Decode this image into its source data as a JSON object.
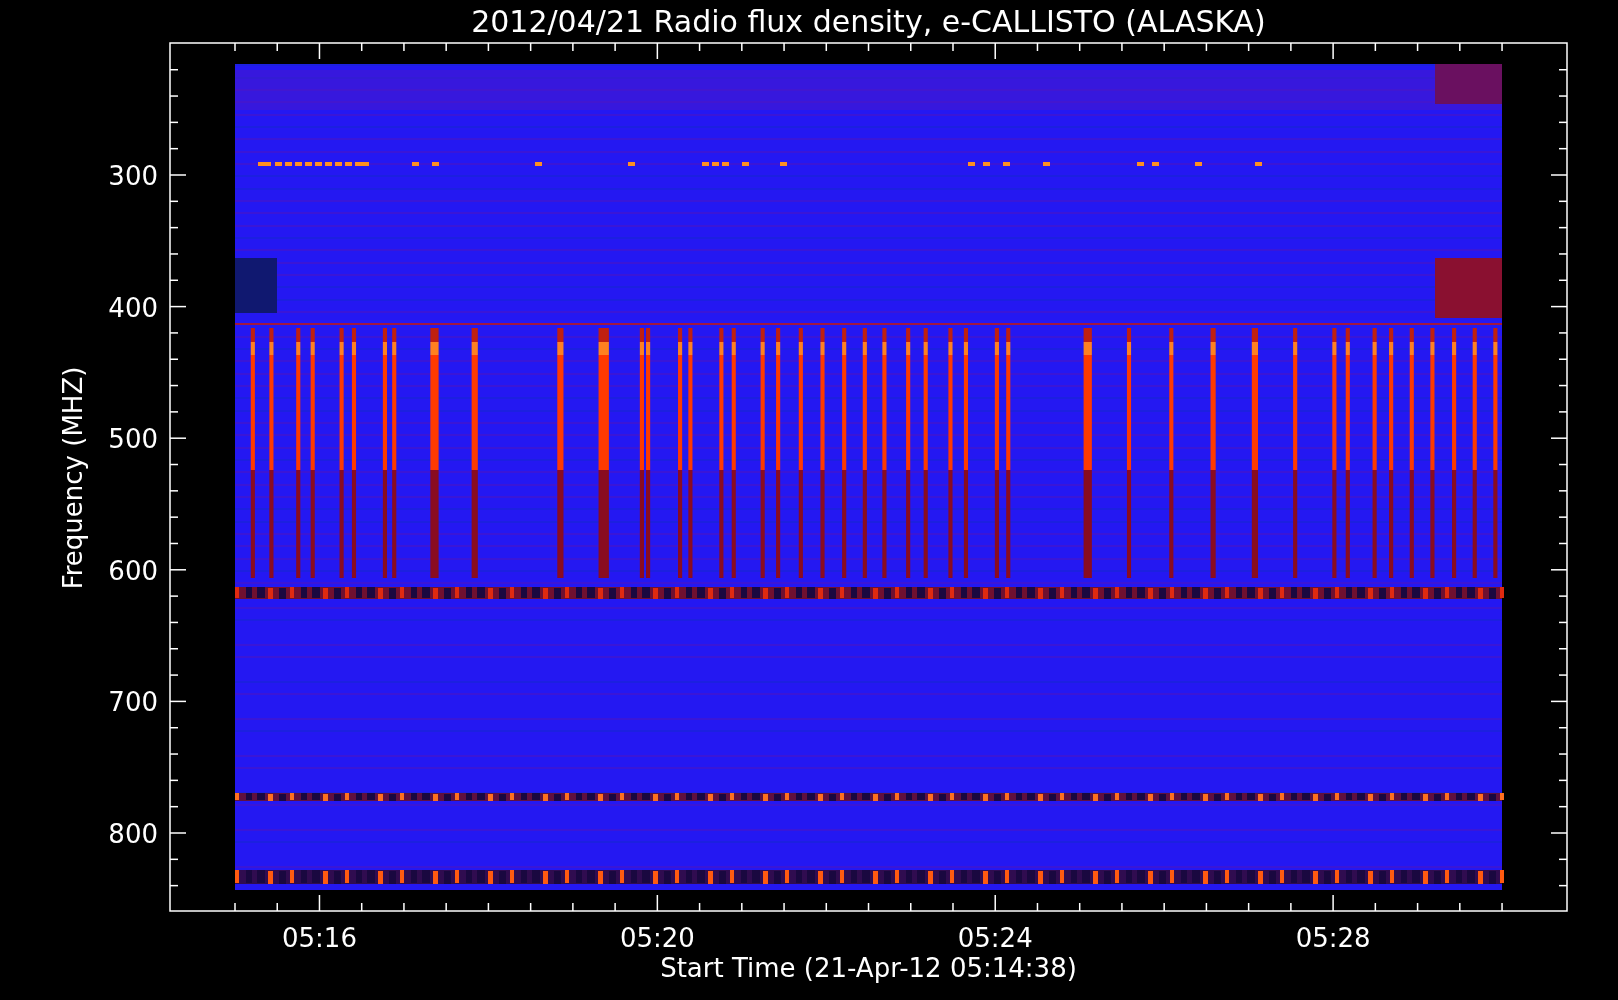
{
  "plot": {
    "title": "2012/04/21  Radio flux density, e-CALLISTO (ALASKA)",
    "ylabel": "Frequency (MHZ)",
    "xlabel": "Start Time (21-Apr-12 05:14:38)",
    "ytick_labels": [
      "300",
      "400",
      "500",
      "600",
      "700",
      "800"
    ],
    "xtick_labels": [
      "05:16",
      "05:20",
      "05:24",
      "05:28"
    ]
  }
}
